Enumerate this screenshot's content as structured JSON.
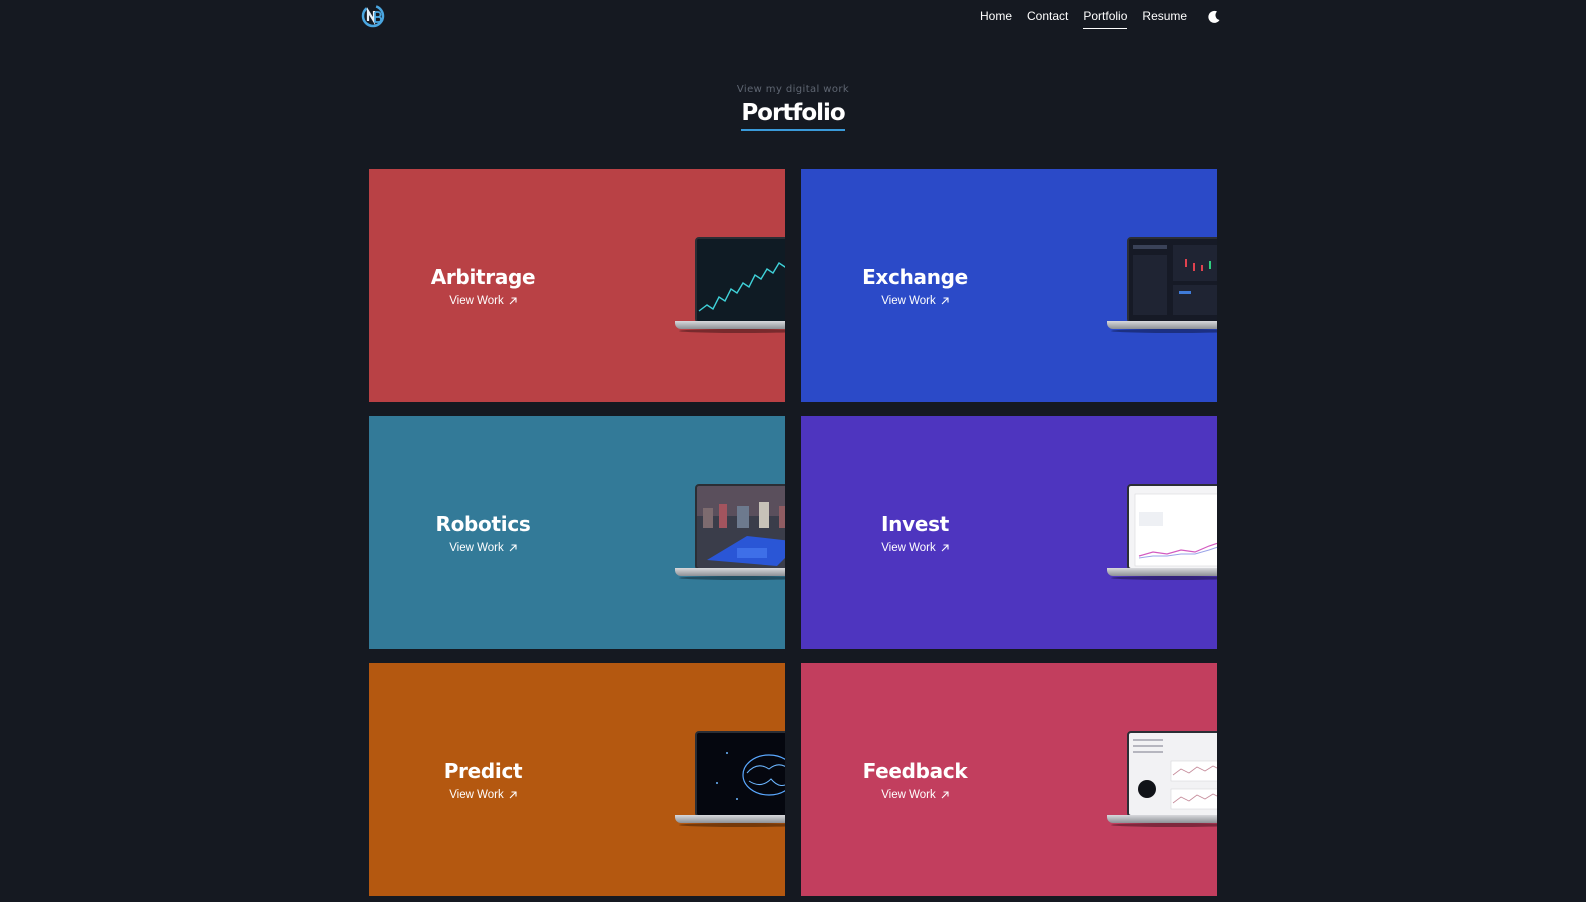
{
  "header": {
    "logo_alt": "NB",
    "nav": [
      {
        "label": "Home",
        "active": false
      },
      {
        "label": "Contact",
        "active": false
      },
      {
        "label": "Portfolio",
        "active": true
      },
      {
        "label": "Resume",
        "active": false
      }
    ],
    "theme_icon": "moon-icon"
  },
  "hero": {
    "subtitle": "View my digital work",
    "title": "Portfolio",
    "underline_color": "#3a9ad9"
  },
  "cards": [
    {
      "title": "Arbitrage",
      "link_label": "View Work",
      "color": "#b94145",
      "screen": "line-chart"
    },
    {
      "title": "Exchange",
      "link_label": "View Work",
      "color": "#2b4ac8",
      "screen": "dashboard"
    },
    {
      "title": "Robotics",
      "link_label": "View Work",
      "color": "#337a98",
      "screen": "photo"
    },
    {
      "title": "Invest",
      "link_label": "View Work",
      "color": "#4e35bf",
      "screen": "plot"
    },
    {
      "title": "Predict",
      "link_label": "View Work",
      "color": "#b45810",
      "screen": "brain"
    },
    {
      "title": "Feedback",
      "link_label": "View Work",
      "color": "#c23e5e",
      "screen": "report"
    }
  ]
}
